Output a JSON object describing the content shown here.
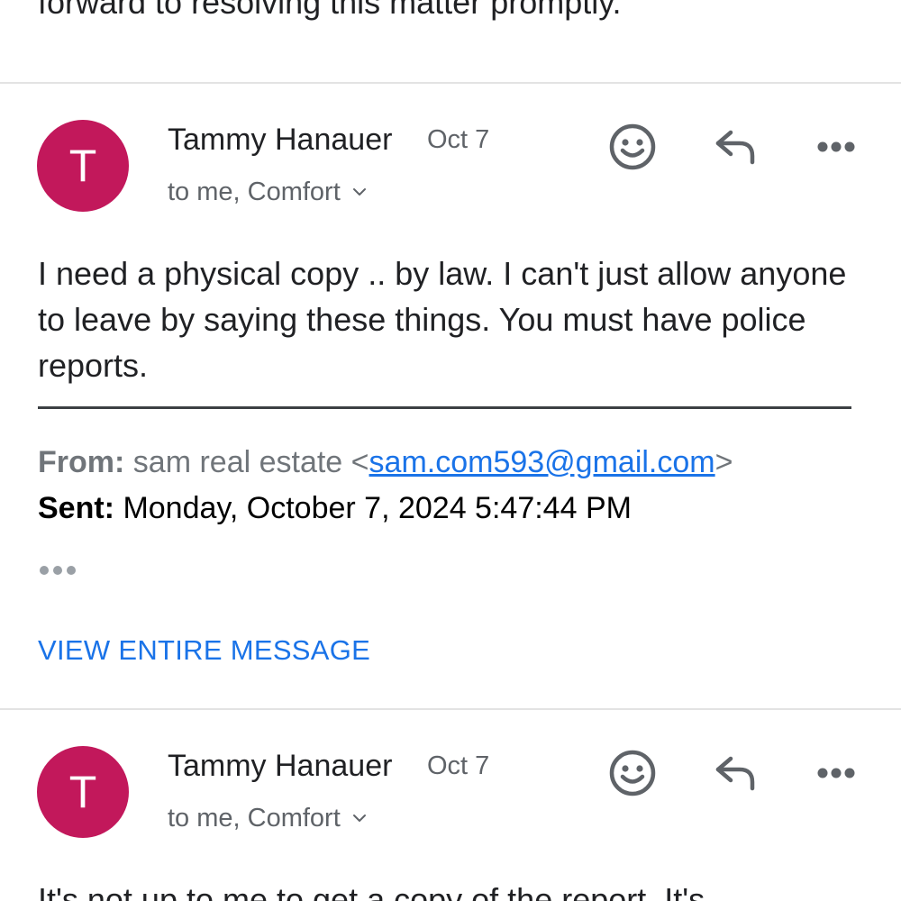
{
  "previous_message": {
    "trailing_text": "forward to resolving this matter promptly."
  },
  "messages": [
    {
      "avatar_initial": "T",
      "avatar_color": "#c2185b",
      "sender": "Tammy Hanauer",
      "date": "Oct 7",
      "recipients": "to me, Comfort",
      "actions": {
        "react_icon": "smiley-face-icon",
        "reply_icon": "reply-arrow-icon",
        "more_icon": "more-horizontal-icon"
      },
      "body": "I need a physical copy .. by law. I can't just allow anyone to leave by saying these things. You must have police reports.",
      "quoted": {
        "from_label": "From:",
        "from_name": "sam real estate <",
        "from_email": "sam.com593@gmail.com",
        "from_close": ">",
        "sent_label": "Sent:",
        "sent_value": "Monday, October 7, 2024 5:47:44 PM"
      },
      "view_entire_label": "VIEW ENTIRE MESSAGE"
    },
    {
      "avatar_initial": "T",
      "avatar_color": "#c2185b",
      "sender": "Tammy Hanauer",
      "date": "Oct 7",
      "recipients": "to me, Comfort",
      "actions": {
        "react_icon": "smiley-face-icon",
        "reply_icon": "reply-arrow-icon",
        "more_icon": "more-horizontal-icon"
      },
      "body": "It's not up to me to get a copy of the report. It's"
    }
  ],
  "colors": {
    "accent_link": "#1a73e8",
    "divider": "#e3e3e3",
    "icon_grey": "#5f6368"
  }
}
